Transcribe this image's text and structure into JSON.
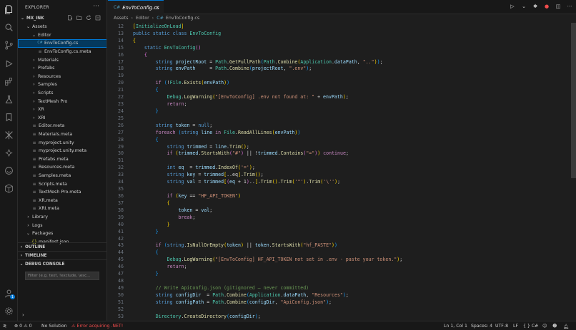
{
  "explorer": {
    "header": "EXPLORER",
    "more": "···",
    "root": "MX_INK",
    "tree": [
      {
        "label": "Assets",
        "depth": 1,
        "kind": "folder-open"
      },
      {
        "label": "Editor",
        "depth": 2,
        "kind": "folder-open"
      },
      {
        "label": "EnvToConfig.cs",
        "depth": 3,
        "kind": "cs",
        "selected": true
      },
      {
        "label": "EnvToConfig.cs.meta",
        "depth": 3,
        "kind": "file"
      },
      {
        "label": "Materials",
        "depth": 2,
        "kind": "folder"
      },
      {
        "label": "Prefabs",
        "depth": 2,
        "kind": "folder"
      },
      {
        "label": "Resources",
        "depth": 2,
        "kind": "folder"
      },
      {
        "label": "Samples",
        "depth": 2,
        "kind": "folder"
      },
      {
        "label": "Scripts",
        "depth": 2,
        "kind": "folder"
      },
      {
        "label": "TextMesh Pro",
        "depth": 2,
        "kind": "folder"
      },
      {
        "label": "XR",
        "depth": 2,
        "kind": "folder"
      },
      {
        "label": "XRI",
        "depth": 2,
        "kind": "folder"
      },
      {
        "label": "Editor.meta",
        "depth": 2,
        "kind": "file"
      },
      {
        "label": "Materials.meta",
        "depth": 2,
        "kind": "file"
      },
      {
        "label": "myproject.unity",
        "depth": 2,
        "kind": "file"
      },
      {
        "label": "myproject.unity.meta",
        "depth": 2,
        "kind": "file"
      },
      {
        "label": "Prefabs.meta",
        "depth": 2,
        "kind": "file"
      },
      {
        "label": "Resources.meta",
        "depth": 2,
        "kind": "file"
      },
      {
        "label": "Samples.meta",
        "depth": 2,
        "kind": "file"
      },
      {
        "label": "Scripts.meta",
        "depth": 2,
        "kind": "file"
      },
      {
        "label": "TextMesh Pro.meta",
        "depth": 2,
        "kind": "file"
      },
      {
        "label": "XR.meta",
        "depth": 2,
        "kind": "file"
      },
      {
        "label": "XRI.meta",
        "depth": 2,
        "kind": "file"
      },
      {
        "label": "Library",
        "depth": 1,
        "kind": "folder"
      },
      {
        "label": "Logs",
        "depth": 1,
        "kind": "folder"
      },
      {
        "label": "Packages",
        "depth": 1,
        "kind": "folder-open"
      },
      {
        "label": "manifest.json",
        "depth": 2,
        "kind": "json"
      }
    ],
    "sections": [
      "OUTLINE",
      "TIMELINE",
      "DEBUG CONSOLE"
    ],
    "filter_placeholder": "Filter (e.g. text, !exclude, \\esc..."
  },
  "editor": {
    "tab_label": "EnvToConfig.cs",
    "breadcrumb": [
      "Assets",
      "Editor",
      "EnvToConfig.cs"
    ],
    "first_line": 12,
    "lines": [
      [
        [
          "b1",
          "["
        ],
        [
          "at",
          "InitializeOnLoad"
        ],
        [
          "b1",
          "]"
        ]
      ],
      [
        [
          "kw",
          "public static class "
        ],
        [
          "ty",
          "EnvToConfig"
        ]
      ],
      [
        [
          "b1",
          "{"
        ]
      ],
      [
        [
          "pl",
          "    "
        ],
        [
          "kw",
          "static "
        ],
        [
          "ty",
          "EnvToConfig"
        ],
        [
          "b2",
          "()"
        ]
      ],
      [
        [
          "pl",
          "    "
        ],
        [
          "b2",
          "{"
        ]
      ],
      [
        [
          "pl",
          "        "
        ],
        [
          "kw",
          "string "
        ],
        [
          "vr",
          "projectRoot"
        ],
        [
          "pl",
          " = "
        ],
        [
          "ty",
          "Path"
        ],
        [
          "pl",
          "."
        ],
        [
          "fn",
          "GetFullPath"
        ],
        [
          "b3",
          "("
        ],
        [
          "ty",
          "Path"
        ],
        [
          "pl",
          "."
        ],
        [
          "fn",
          "Combine"
        ],
        [
          "b1",
          "("
        ],
        [
          "ty",
          "Application"
        ],
        [
          "pl",
          "."
        ],
        [
          "vr",
          "dataPath"
        ],
        [
          "pl",
          ", "
        ],
        [
          "str",
          "\"..\""
        ],
        [
          "b1",
          ")"
        ],
        [
          "b3",
          ")"
        ],
        [
          "pl",
          ";"
        ]
      ],
      [
        [
          "pl",
          "        "
        ],
        [
          "kw",
          "string "
        ],
        [
          "vr",
          "envPath"
        ],
        [
          "pl",
          "     = "
        ],
        [
          "ty",
          "Path"
        ],
        [
          "pl",
          "."
        ],
        [
          "fn",
          "Combine"
        ],
        [
          "b3",
          "("
        ],
        [
          "vr",
          "projectRoot"
        ],
        [
          "pl",
          ", "
        ],
        [
          "str",
          "\".env\""
        ],
        [
          "b3",
          ")"
        ],
        [
          "pl",
          ";"
        ]
      ],
      [],
      [
        [
          "pl",
          "        "
        ],
        [
          "kw2",
          "if "
        ],
        [
          "b3",
          "("
        ],
        [
          "pl",
          "!"
        ],
        [
          "ty",
          "File"
        ],
        [
          "pl",
          "."
        ],
        [
          "fn",
          "Exists"
        ],
        [
          "b1",
          "("
        ],
        [
          "vr",
          "envPath"
        ],
        [
          "b1",
          ")"
        ],
        [
          "b3",
          ")"
        ]
      ],
      [
        [
          "pl",
          "        "
        ],
        [
          "b3",
          "{"
        ]
      ],
      [
        [
          "pl",
          "            "
        ],
        [
          "ty",
          "Debug"
        ],
        [
          "pl",
          "."
        ],
        [
          "fn",
          "LogWarning"
        ],
        [
          "b1",
          "("
        ],
        [
          "str",
          "\"[EnvToConfig] .env not found at: \""
        ],
        [
          "pl",
          " + "
        ],
        [
          "vr",
          "envPath"
        ],
        [
          "b1",
          ")"
        ],
        [
          "pl",
          ";"
        ]
      ],
      [
        [
          "pl",
          "            "
        ],
        [
          "kw2",
          "return"
        ],
        [
          "pl",
          ";"
        ]
      ],
      [
        [
          "pl",
          "        "
        ],
        [
          "b3",
          "}"
        ]
      ],
      [],
      [
        [
          "pl",
          "        "
        ],
        [
          "kw",
          "string "
        ],
        [
          "vr",
          "token"
        ],
        [
          "pl",
          " = "
        ],
        [
          "kw",
          "null"
        ],
        [
          "pl",
          ";"
        ]
      ],
      [
        [
          "pl",
          "        "
        ],
        [
          "kw2",
          "foreach "
        ],
        [
          "b3",
          "("
        ],
        [
          "kw",
          "string "
        ],
        [
          "vr",
          "line "
        ],
        [
          "kw2",
          "in "
        ],
        [
          "ty",
          "File"
        ],
        [
          "pl",
          "."
        ],
        [
          "fn",
          "ReadAllLines"
        ],
        [
          "b1",
          "("
        ],
        [
          "vr",
          "envPath"
        ],
        [
          "b1",
          ")"
        ],
        [
          "b3",
          ")"
        ]
      ],
      [
        [
          "pl",
          "        "
        ],
        [
          "b3",
          "{"
        ]
      ],
      [
        [
          "pl",
          "            "
        ],
        [
          "kw",
          "string "
        ],
        [
          "vr",
          "trimmed"
        ],
        [
          "pl",
          " = "
        ],
        [
          "vr",
          "line"
        ],
        [
          "pl",
          "."
        ],
        [
          "fn",
          "Trim"
        ],
        [
          "b1",
          "()"
        ],
        [
          "pl",
          ";"
        ]
      ],
      [
        [
          "pl",
          "            "
        ],
        [
          "kw2",
          "if "
        ],
        [
          "b1",
          "("
        ],
        [
          "vr",
          "trimmed"
        ],
        [
          "pl",
          "."
        ],
        [
          "fn",
          "StartsWith"
        ],
        [
          "b2",
          "("
        ],
        [
          "str",
          "\"#\""
        ],
        [
          "b2",
          ")"
        ],
        [
          "pl",
          " || !"
        ],
        [
          "vr",
          "trimmed"
        ],
        [
          "pl",
          "."
        ],
        [
          "fn",
          "Contains"
        ],
        [
          "b2",
          "("
        ],
        [
          "str",
          "\"=\""
        ],
        [
          "b2",
          ")"
        ],
        [
          "b1",
          ")"
        ],
        [
          "kw2",
          " continue"
        ],
        [
          "pl",
          ";"
        ]
      ],
      [],
      [
        [
          "pl",
          "            "
        ],
        [
          "kw",
          "int "
        ],
        [
          "vr",
          "eq"
        ],
        [
          "pl",
          "  = "
        ],
        [
          "vr",
          "trimmed"
        ],
        [
          "pl",
          "."
        ],
        [
          "fn",
          "IndexOf"
        ],
        [
          "b1",
          "("
        ],
        [
          "str",
          "'='"
        ],
        [
          "b1",
          ")"
        ],
        [
          "pl",
          ";"
        ]
      ],
      [
        [
          "pl",
          "            "
        ],
        [
          "kw",
          "string "
        ],
        [
          "vr",
          "key"
        ],
        [
          "pl",
          " = "
        ],
        [
          "vr",
          "trimmed"
        ],
        [
          "b1",
          "["
        ],
        [
          "pl",
          "..eq"
        ],
        [
          "b1",
          "]"
        ],
        [
          "pl",
          "."
        ],
        [
          "fn",
          "Trim"
        ],
        [
          "b1",
          "()"
        ],
        [
          "pl",
          ";"
        ]
      ],
      [
        [
          "pl",
          "            "
        ],
        [
          "kw",
          "string "
        ],
        [
          "vr",
          "val"
        ],
        [
          "pl",
          " = "
        ],
        [
          "vr",
          "trimmed"
        ],
        [
          "b1",
          "["
        ],
        [
          "b2",
          "("
        ],
        [
          "vr",
          "eq"
        ],
        [
          "pl",
          " + 1"
        ],
        [
          "b2",
          ")"
        ],
        [
          "pl",
          ".."
        ],
        [
          "b1",
          "]"
        ],
        [
          "pl",
          "."
        ],
        [
          "fn",
          "Trim"
        ],
        [
          "b1",
          "()"
        ],
        [
          "pl",
          "."
        ],
        [
          "fn",
          "Trim"
        ],
        [
          "b1",
          "("
        ],
        [
          "str",
          "'\"'"
        ],
        [
          "b1",
          ")"
        ],
        [
          "pl",
          "."
        ],
        [
          "fn",
          "Trim"
        ],
        [
          "b1",
          "("
        ],
        [
          "str",
          "'\\''"
        ],
        [
          "b1",
          ")"
        ],
        [
          "pl",
          ";"
        ]
      ],
      [],
      [
        [
          "pl",
          "            "
        ],
        [
          "kw2",
          "if "
        ],
        [
          "b1",
          "("
        ],
        [
          "vr",
          "key"
        ],
        [
          "pl",
          " == "
        ],
        [
          "str",
          "\"HF_API_TOKEN\""
        ],
        [
          "b1",
          ")"
        ]
      ],
      [
        [
          "pl",
          "            "
        ],
        [
          "b1",
          "{"
        ]
      ],
      [
        [
          "pl",
          "                "
        ],
        [
          "vr",
          "token"
        ],
        [
          "pl",
          " = "
        ],
        [
          "vr",
          "val"
        ],
        [
          "pl",
          ";"
        ]
      ],
      [
        [
          "pl",
          "                "
        ],
        [
          "kw2",
          "break"
        ],
        [
          "pl",
          ";"
        ]
      ],
      [
        [
          "pl",
          "            "
        ],
        [
          "b1",
          "}"
        ]
      ],
      [
        [
          "pl",
          "        "
        ],
        [
          "b3",
          "}"
        ]
      ],
      [],
      [
        [
          "pl",
          "        "
        ],
        [
          "kw2",
          "if "
        ],
        [
          "b3",
          "("
        ],
        [
          "kw",
          "string"
        ],
        [
          "pl",
          "."
        ],
        [
          "fn",
          "IsNullOrEmpty"
        ],
        [
          "b1",
          "("
        ],
        [
          "vr",
          "token"
        ],
        [
          "b1",
          ")"
        ],
        [
          "pl",
          " || "
        ],
        [
          "vr",
          "token"
        ],
        [
          "pl",
          "."
        ],
        [
          "fn",
          "StartsWith"
        ],
        [
          "b1",
          "("
        ],
        [
          "str",
          "\"hf_PASTE\""
        ],
        [
          "b1",
          ")"
        ],
        [
          "b3",
          ")"
        ]
      ],
      [
        [
          "pl",
          "        "
        ],
        [
          "b3",
          "{"
        ]
      ],
      [
        [
          "pl",
          "            "
        ],
        [
          "ty",
          "Debug"
        ],
        [
          "pl",
          "."
        ],
        [
          "fn",
          "LogWarning"
        ],
        [
          "b1",
          "("
        ],
        [
          "str",
          "\"[EnvToConfig] HF_API_TOKEN not set in .env - paste your token.\""
        ],
        [
          "b1",
          ")"
        ],
        [
          "pl",
          ";"
        ]
      ],
      [
        [
          "pl",
          "            "
        ],
        [
          "kw2",
          "return"
        ],
        [
          "pl",
          ";"
        ]
      ],
      [
        [
          "pl",
          "        "
        ],
        [
          "b3",
          "}"
        ]
      ],
      [],
      [
        [
          "pl",
          "        "
        ],
        [
          "cm",
          "// Write ApiConfig.json (gitignored — never committed)"
        ]
      ],
      [
        [
          "pl",
          "        "
        ],
        [
          "kw",
          "string "
        ],
        [
          "vr",
          "configDir"
        ],
        [
          "pl",
          "  = "
        ],
        [
          "ty",
          "Path"
        ],
        [
          "pl",
          "."
        ],
        [
          "fn",
          "Combine"
        ],
        [
          "b3",
          "("
        ],
        [
          "ty",
          "Application"
        ],
        [
          "pl",
          "."
        ],
        [
          "vr",
          "dataPath"
        ],
        [
          "pl",
          ", "
        ],
        [
          "str",
          "\"Resources\""
        ],
        [
          "b3",
          ")"
        ],
        [
          "pl",
          ";"
        ]
      ],
      [
        [
          "pl",
          "        "
        ],
        [
          "kw",
          "string "
        ],
        [
          "vr",
          "configPath"
        ],
        [
          "pl",
          " = "
        ],
        [
          "ty",
          "Path"
        ],
        [
          "pl",
          "."
        ],
        [
          "fn",
          "Combine"
        ],
        [
          "b3",
          "("
        ],
        [
          "vr",
          "configDir"
        ],
        [
          "pl",
          ", "
        ],
        [
          "str",
          "\"ApiConfig.json\""
        ],
        [
          "b3",
          ")"
        ],
        [
          "pl",
          ";"
        ]
      ],
      [],
      [
        [
          "pl",
          "        "
        ],
        [
          "ty",
          "Directory"
        ],
        [
          "pl",
          "."
        ],
        [
          "fn",
          "CreateDirectory"
        ],
        [
          "b3",
          "("
        ],
        [
          "vr",
          "configDir"
        ],
        [
          "b3",
          ")"
        ],
        [
          "pl",
          ";"
        ]
      ]
    ]
  },
  "statusbar": {
    "remote": "≷",
    "errors": "0",
    "warnings": "0",
    "solution": "No Solution",
    "error_msg": "Error acquiring .NET!",
    "position": "Ln 1, Col 1",
    "spaces": "Spaces: 4",
    "encoding": "UTF-8",
    "eol": "LF",
    "language": "C#",
    "braces": "{ }"
  },
  "colors": {
    "accent": "#0078d4",
    "error": "#f14c4c",
    "csharp_icon": "#519aba"
  }
}
